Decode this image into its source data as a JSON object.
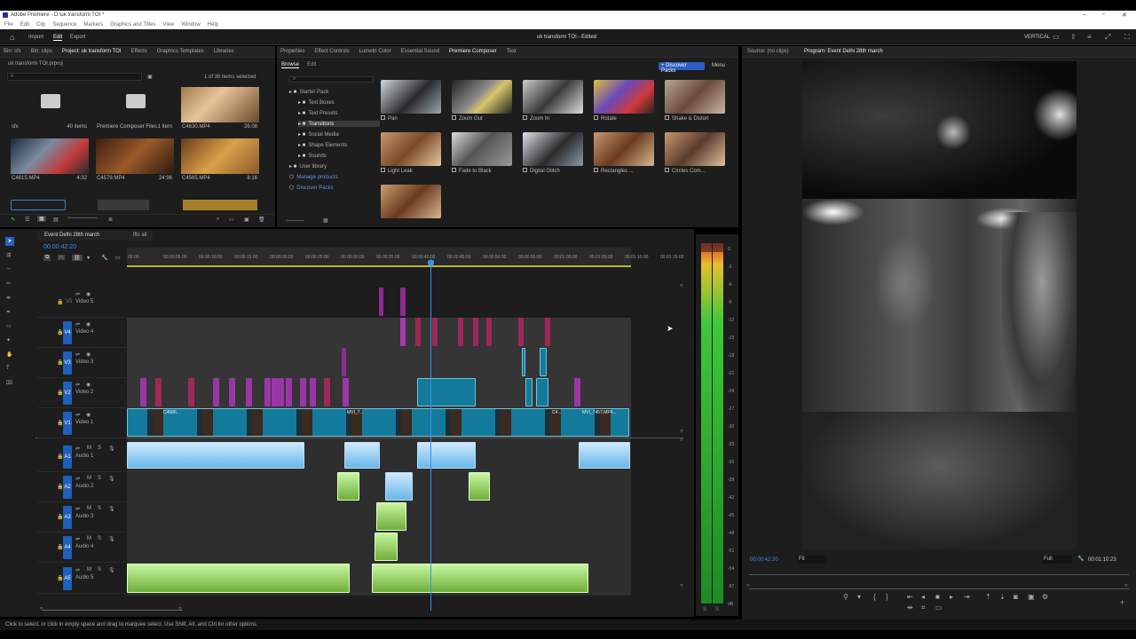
{
  "window": {
    "title": "Adobe Premiere - D:\\uk transform TOI *"
  },
  "menu": [
    "File",
    "Edit",
    "Clip",
    "Sequence",
    "Markers",
    "Graphics and Titles",
    "View",
    "Window",
    "Help"
  ],
  "header": {
    "import": "Import",
    "edit": "Edit",
    "export": "Export",
    "project_title": "uk transform TOI - Edited",
    "vertical": "VERTICAL"
  },
  "project_panel": {
    "tabs": [
      "Bin: sfx",
      "Bin: clips",
      "Project: uk transform TOI",
      "Effects",
      "Graphics Templates",
      "Libraries"
    ],
    "path": "uk transform TOI.prproj",
    "selection": "1 of 36 items selected",
    "items": [
      {
        "name": "sfx",
        "meta": "40 items"
      },
      {
        "name": "Premiere Composer Files",
        "meta": "1 item"
      },
      {
        "name": "C4630.MP4",
        "meta": "26:08"
      },
      {
        "name": "C4615.MP4",
        "meta": "4:32"
      },
      {
        "name": "C4579.MP4",
        "meta": "24:96"
      },
      {
        "name": "C4565.MP4",
        "meta": "8:16"
      }
    ]
  },
  "composer_panel": {
    "tabs": [
      "Properties",
      "Effect Controls",
      "Lumetri Color",
      "Essential Sound",
      "Premiere Composer",
      "Text"
    ],
    "subtabs": [
      "Browse",
      "Edit"
    ],
    "discover_button": "+ Discover Packs",
    "menu_button": "Menu",
    "tree": [
      "Starter Pack",
      "Text Boxes",
      "Text Presets",
      "Transitions",
      "Social Media",
      "Shape Elements",
      "Sounds",
      "User library",
      "Manage products",
      "Discover Packs"
    ],
    "presets": [
      "Pan",
      "Zoom Out",
      "Zoom In",
      "Rotate",
      "Shake & Distort",
      "Light Leak",
      "Fade to Black",
      "Digital Glitch",
      "Rectangles ...",
      "Circles Com..."
    ]
  },
  "source_panel": {
    "tab": "Source: (no clips)"
  },
  "program_panel": {
    "tab": "Program: Event Delhi 28th march",
    "timecode": "00:00:42:20",
    "fit": "Fit",
    "quality": "Full",
    "duration": "00:01:10:23"
  },
  "timeline": {
    "tabs": [
      "Event Delhi 28th march",
      "lfts all"
    ],
    "timecode": "00:00:42:20",
    "ruler": [
      "00:00",
      "00:00:05:00",
      "00:00:10:00",
      "00:00:15:00",
      "00:00:20:00",
      "00:00:25:00",
      "00:00:30:00",
      "00:00:35:00",
      "00:00:40:00",
      "00:00:45:00",
      "00:00:50:00",
      "00:00:55:00",
      "00:01:00:00",
      "00:01:05:00",
      "00:01:10:00",
      "00:01:15:00"
    ],
    "video_tracks": [
      {
        "id": "V5",
        "name": "Video 5"
      },
      {
        "id": "V4",
        "name": "Video 4"
      },
      {
        "id": "V3",
        "name": "Video 3"
      },
      {
        "id": "V2",
        "name": "Video 2"
      },
      {
        "id": "V1",
        "name": "Video 1"
      }
    ],
    "audio_tracks": [
      {
        "id": "A1",
        "name": "Audio 1"
      },
      {
        "id": "A2",
        "name": "Audio 2"
      },
      {
        "id": "A3",
        "name": "Audio 3"
      },
      {
        "id": "A4",
        "name": "Audio 4"
      },
      {
        "id": "A5",
        "name": "Audio 5"
      }
    ],
    "clip_names": [
      "C4586...",
      "MVI_7...",
      "C4...",
      "MVI_7457.MP4..."
    ]
  },
  "meter": {
    "scale": [
      "0",
      "-3",
      "-6",
      "-9",
      "-12",
      "-15",
      "-18",
      "-21",
      "-24",
      "-27",
      "-30",
      "-33",
      "-36",
      "-39",
      "-42",
      "-45",
      "-48",
      "-51",
      "-54",
      "-57",
      "dB"
    ],
    "bottom": [
      "S",
      "S"
    ]
  },
  "status": "Click to select, or click in empty space and drag to marquee select. Use Shift, Alt, and Ctrl for other options."
}
